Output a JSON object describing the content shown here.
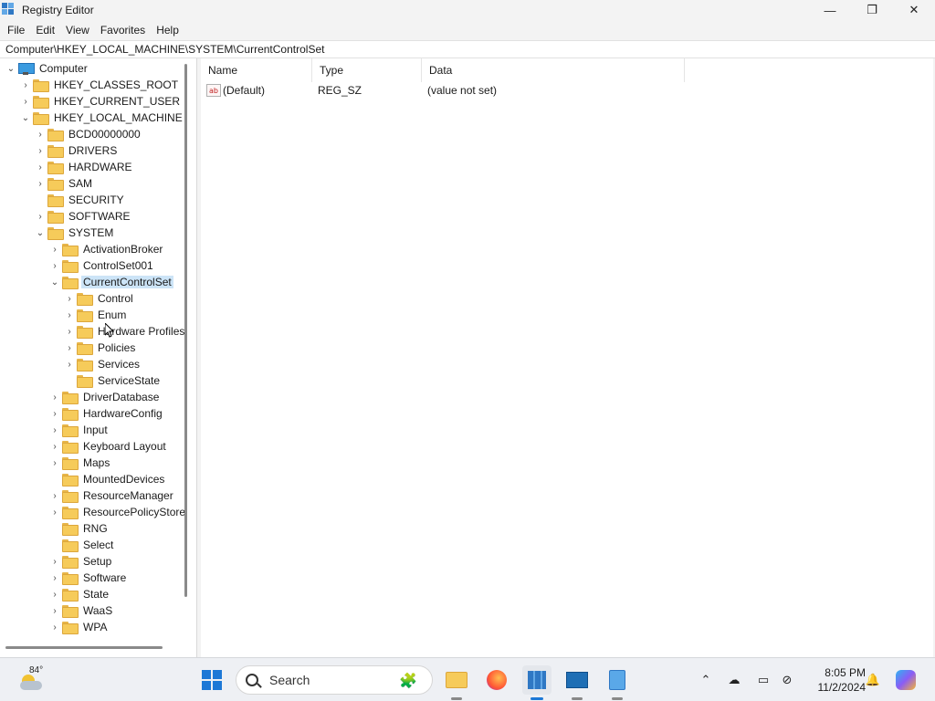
{
  "window": {
    "title": "Registry Editor",
    "minimize": "—",
    "maximize": "❐",
    "close": "✕"
  },
  "menu": [
    "File",
    "Edit",
    "View",
    "Favorites",
    "Help"
  ],
  "address": "Computer\\HKEY_LOCAL_MACHINE\\SYSTEM\\CurrentControlSet",
  "tree": {
    "root": "Computer",
    "hives": {
      "classes_root": "HKEY_CLASSES_ROOT",
      "current_user": "HKEY_CURRENT_USER",
      "local_machine": "HKEY_LOCAL_MACHINE"
    },
    "hklm_children": [
      "BCD00000000",
      "DRIVERS",
      "HARDWARE",
      "SAM",
      "SECURITY",
      "SOFTWARE",
      "SYSTEM"
    ],
    "system_children": [
      "ActivationBroker",
      "ControlSet001",
      "CurrentControlSet"
    ],
    "ccs_children": [
      "Control",
      "Enum",
      "Hardware Profiles",
      "Policies",
      "Services",
      "ServiceState"
    ],
    "system_children_after": [
      "DriverDatabase",
      "HardwareConfig",
      "Input",
      "Keyboard Layout",
      "Maps",
      "MountedDevices",
      "ResourceManager",
      "ResourcePolicyStore",
      "RNG",
      "Select",
      "Setup",
      "Software",
      "State",
      "WaaS",
      "WPA"
    ]
  },
  "list": {
    "columns": [
      "Name",
      "Type",
      "Data"
    ],
    "rows": [
      {
        "name": "(Default)",
        "type": "REG_SZ",
        "data": "(value not set)"
      }
    ]
  },
  "taskbar": {
    "weather_temp": "84°",
    "search_placeholder": "Search",
    "time": "8:05 PM",
    "date": "11/2/2024"
  }
}
